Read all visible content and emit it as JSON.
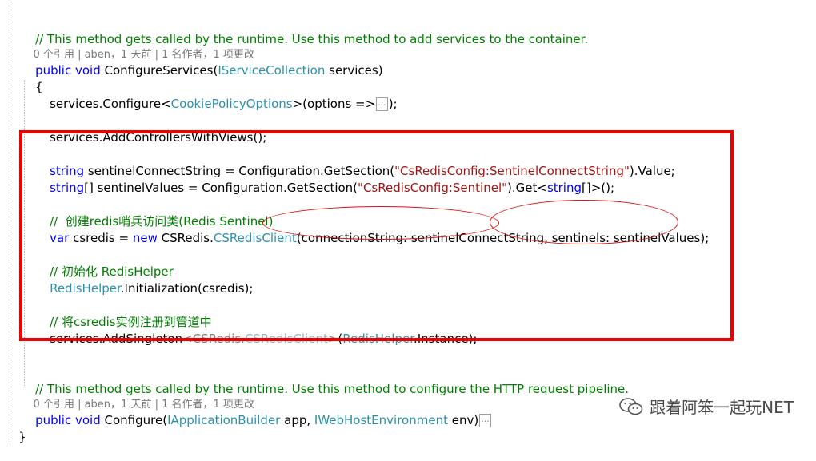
{
  "code": {
    "comment1": "// This method gets called by the runtime. Use this method to add services to the container.",
    "lens1": "0 个引用 | aben，1 天前 | 1 名作者，1 项更改",
    "sig1_kw": "public void",
    "sig1_name": " ConfigureServices(",
    "sig1_type": "IServiceCollection",
    "sig1_rest": " services)",
    "open_brace": "{",
    "l1_a": "services.Configure<",
    "l1_type": "CookiePolicyOptions",
    "l1_b": ">(options =>",
    "collapsed": "...",
    "l1_c": ");",
    "l2": "services.AddControllersWithViews();",
    "l3_kw": "string",
    "l3_a": " sentinelConnectString = Configuration.GetSection(",
    "l3_str": "\"CsRedisConfig:SentinelConnectString\"",
    "l3_b": ").Value;",
    "l4_kw": "string",
    "l4_a": "[] sentinelValues = Configuration.GetSection(",
    "l4_str": "\"CsRedisConfig:Sentinel\"",
    "l4_b": ").Get<",
    "l4_kw2": "string",
    "l4_c": "[]>();",
    "c1": "//  创建redis哨兵访问类(Redis Sentinel)",
    "l5_kw": "var",
    "l5_a": " csredis = ",
    "l5_kw2": "new",
    "l5_b": " CSRedis.",
    "l5_type": "CSRedisClient",
    "l5_c": "(connectionString: sentinelConnectString, sentinels: sentinelValues);",
    "c2": "// 初始化 RedisHelper",
    "l6_type": "RedisHelper",
    "l6_a": ".Initialization(csredis);",
    "c3": "// 将csredis实例注册到管道中",
    "l7_a": "services.AddSingleton",
    "l7_gray1": "<CSRedis.",
    "l7_type_gray": "CSRedisClient",
    "l7_gray2": ">",
    "l7_b": "(",
    "l7_type": "RedisHelper",
    "l7_c": ".Instance);",
    "comment2": "// This method gets called by the runtime. Use this method to configure the HTTP request pipeline.",
    "lens2": "0 个引用 | aben，1 天前 | 1 名作者，1 项更改",
    "sig2_kw": "public void",
    "sig2_name": " Configure(",
    "sig2_type1": "IApplicationBuilder",
    "sig2_mid": " app, ",
    "sig2_type2": "IWebHostEnvironment",
    "sig2_rest": " env)",
    "close_brace": "}"
  },
  "watermark": {
    "icon": "wechat-icon",
    "text": "跟着阿笨一起玩NET"
  },
  "colors": {
    "comment": "#008000",
    "keyword": "#0000ff",
    "type": "#2b91af",
    "string": "#a31515",
    "highlight_box": "#ee0000"
  }
}
